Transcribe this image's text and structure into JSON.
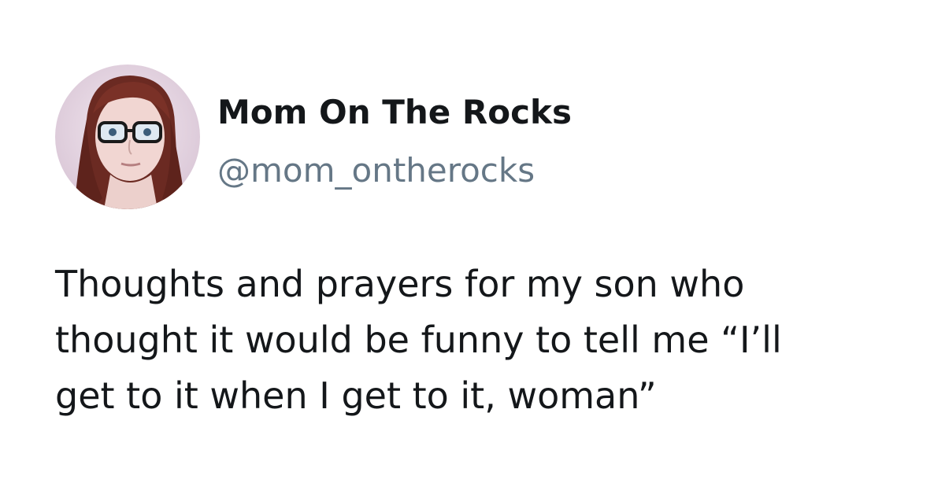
{
  "author": {
    "display_name": "Mom On The Rocks",
    "handle": "@mom_ontherocks",
    "avatar_icon": "profile-photo-avatar"
  },
  "tweet": {
    "lines": [
      "Thoughts and prayers for my son who",
      "thought it would be funny to tell me “I’ll",
      "get to it when I get to it, woman”"
    ]
  },
  "colors": {
    "text_primary": "#14171a",
    "text_secondary": "#657786",
    "background": "#ffffff"
  }
}
